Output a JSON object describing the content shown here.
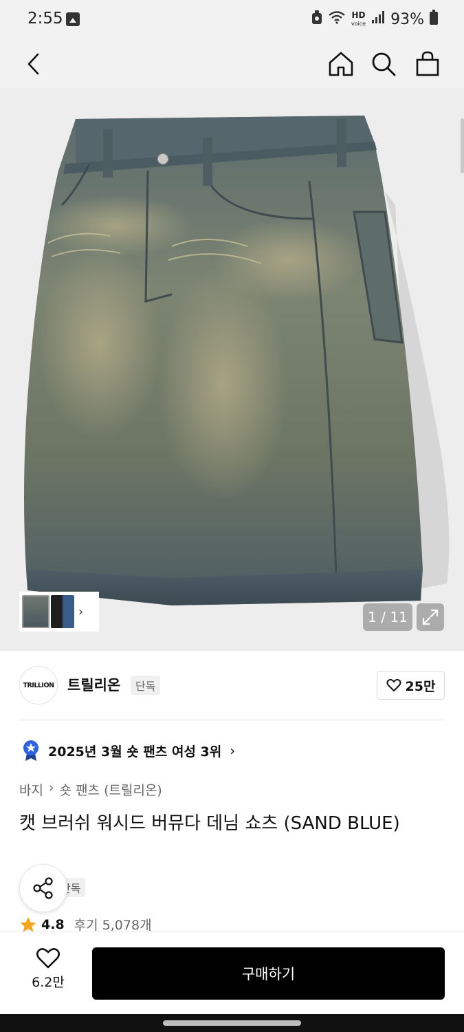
{
  "status_bar": {
    "time": "2:55",
    "network": "HD",
    "battery": "93%",
    "icons": [
      "image-icon",
      "alarm-icon",
      "wifi-icon",
      "signal-icon",
      "battery-icon"
    ]
  },
  "header": {
    "icons": [
      "back-arrow-icon",
      "home-icon",
      "search-icon",
      "shopping-bag-icon"
    ]
  },
  "gallery": {
    "counter": "1 / 11",
    "image_subject": "denim-shorts-image",
    "thumbnails": [
      "thumbnail-1",
      "thumbnail-2"
    ]
  },
  "brand": {
    "logo_text": "TRILLION",
    "name": "트릴리온",
    "exclusive_badge": "단독",
    "likes": "25만"
  },
  "ranking": {
    "text": "2025년 3월 숏 팬츠 여성 3위"
  },
  "breadcrumb": {
    "category": "바지",
    "subcategory": "숏 팬츠 (트릴리온)"
  },
  "product": {
    "title": "캣 브러쉬 워시드 버뮤다 데님 쇼츠 (SAND BLUE)",
    "badge": "단독",
    "rating": "4.8",
    "reviews": "후기 5,078개"
  },
  "bottom_bar": {
    "wish_count": "6.2만",
    "buy_label": "구매하기"
  },
  "colors": {
    "accent": "#000000",
    "star": "#f5a623",
    "rank_badge": "#2f62e0"
  }
}
